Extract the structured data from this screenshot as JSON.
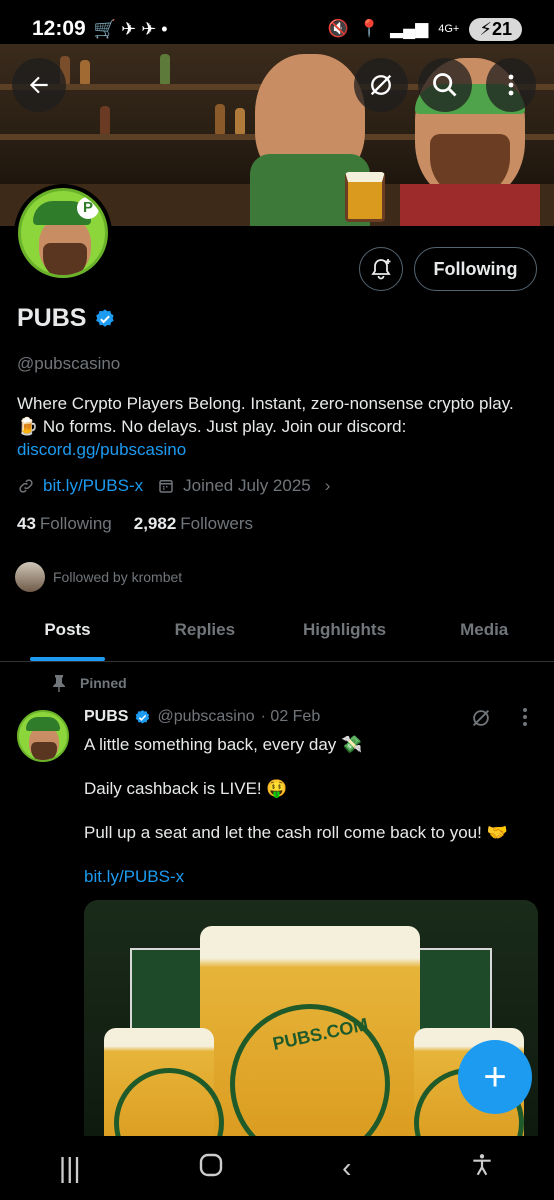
{
  "status_bar": {
    "time": "12:09",
    "battery": "21",
    "network": "4G+"
  },
  "profile": {
    "name": "PUBS",
    "handle": "@pubscasino",
    "bio_line": "Where Crypto Players Belong.  Instant, zero-nonsense crypto play. 🍺 No forms. No delays. Just play.  Join our discord:",
    "bio_link": "discord.gg/pubscasino",
    "website": "bit.ly/PUBS-x",
    "joined": "Joined July 2025",
    "following_count": "43",
    "following_label": "Following",
    "followers_count": "2,982",
    "followers_label": "Followers",
    "followed_by": "Followed by krombet",
    "follow_button": "Following"
  },
  "tabs": [
    "Posts",
    "Replies",
    "Highlights",
    "Media"
  ],
  "post": {
    "pinned_label": "Pinned",
    "name": "PUBS",
    "handle": "@pubscasino",
    "date": "· 02 Feb",
    "line1": "A little something back, every day 💸",
    "line2": "Daily cashback is LIVE! 🤑",
    "line3": "Pull up a seat and let the cash roll come back to you! 🤝",
    "link": "bit.ly/PUBS-x",
    "image_text": "PUBS.COM"
  },
  "colors": {
    "accent": "#1d9bf0",
    "background": "#000000",
    "muted": "#71767b",
    "avatar_green": "#8cd63c"
  },
  "icons": {
    "back": "arrow-left-icon",
    "grok": "grok-icon",
    "search": "search-icon",
    "more": "more-vertical-icon",
    "notify": "bell-plus-icon",
    "verified": "verified-badge-icon",
    "link": "link-icon",
    "calendar": "calendar-icon",
    "pin": "pin-icon",
    "compose": "plus-icon"
  }
}
